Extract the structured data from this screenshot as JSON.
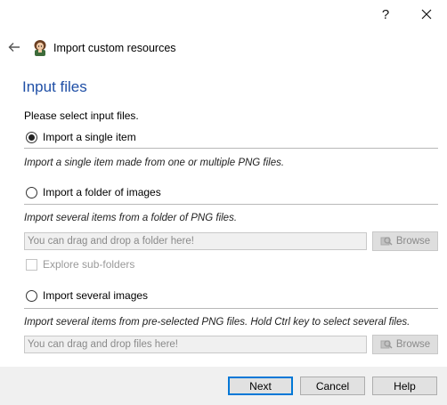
{
  "titlebar": {
    "help_label": "?",
    "close_icon": "close-icon"
  },
  "wizard": {
    "title": "Import custom resources",
    "back_icon": "back-arrow-icon",
    "app_icon": "character-icon"
  },
  "page": {
    "title": "Input files",
    "instruction": "Please select input files."
  },
  "options": {
    "single": {
      "label": "Import a single item",
      "checked": true,
      "description": "Import a single item made from one or multiple PNG files."
    },
    "folder": {
      "label": "Import a folder of images",
      "checked": false,
      "description": "Import several items from a folder of PNG files.",
      "field_placeholder": "You can drag and drop a folder here!",
      "browse_label": "Browse",
      "subfolders_label": "Explore sub-folders"
    },
    "several": {
      "label": "Import several images",
      "checked": false,
      "description": "Import several items from pre-selected PNG files. Hold Ctrl key to select several files.",
      "field_placeholder": "You can drag and drop files here!",
      "browse_label": "Browse"
    }
  },
  "footer": {
    "next_label": "Next",
    "cancel_label": "Cancel",
    "help_label": "Help"
  }
}
